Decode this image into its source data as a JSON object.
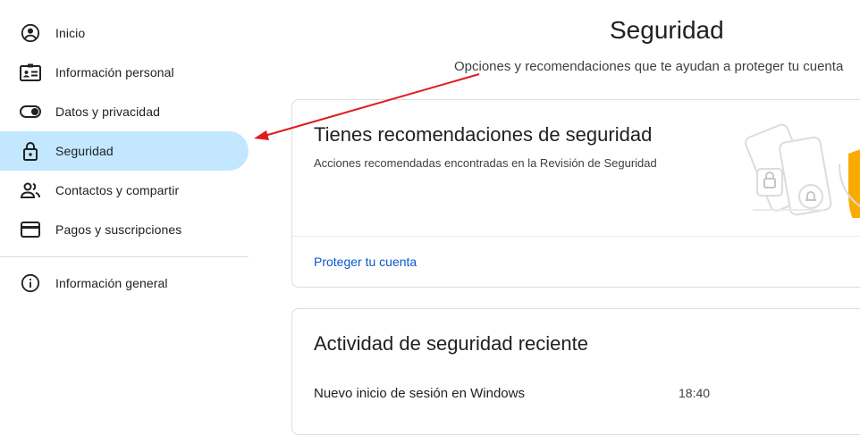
{
  "sidebar": {
    "items": [
      {
        "label": "Inicio",
        "icon": "account-circle-icon"
      },
      {
        "label": "Información personal",
        "icon": "id-card-icon"
      },
      {
        "label": "Datos y privacidad",
        "icon": "toggle-icon"
      },
      {
        "label": "Seguridad",
        "icon": "lock-icon",
        "active": true
      },
      {
        "label": "Contactos y compartir",
        "icon": "people-icon"
      },
      {
        "label": "Pagos y suscripciones",
        "icon": "credit-card-icon"
      },
      {
        "label": "Información general",
        "icon": "info-icon"
      }
    ]
  },
  "main": {
    "title": "Seguridad",
    "subtitle": "Opciones y recomendaciones que te ayudan a proteger tu cuenta",
    "recommendations_card": {
      "title": "Tienes recomendaciones de seguridad",
      "description": "Acciones recomendadas encontradas en la Revisión de Seguridad",
      "link": "Proteger tu cuenta"
    },
    "activity_card": {
      "title": "Actividad de seguridad reciente",
      "rows": [
        {
          "event": "Nuevo inicio de sesión en Windows",
          "time": "18:40"
        }
      ]
    }
  },
  "colors": {
    "active_nav": "#c2e7ff",
    "link": "#0b57d0",
    "annotation_arrow": "#e01b1b",
    "shield": "#f9ab00"
  }
}
